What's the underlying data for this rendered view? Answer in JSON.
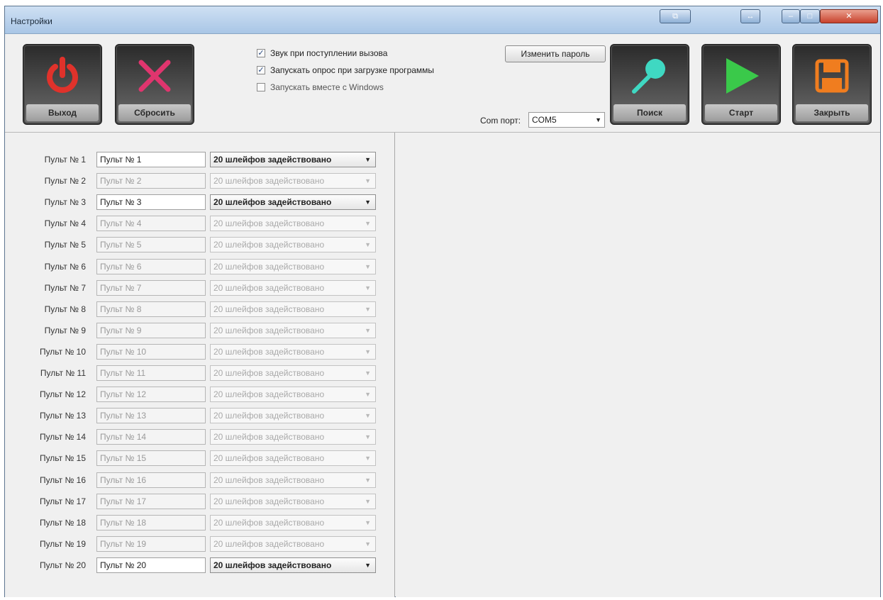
{
  "window": {
    "title": "Настройки"
  },
  "toolbar": {
    "exit_label": "Выход",
    "reset_label": "Сбросить",
    "search_label": "Поиск",
    "start_label": "Старт",
    "close_label": "Закрыть",
    "change_password_label": "Изменить пароль",
    "com_port_label": "Com порт:",
    "com_port_value": "COM5",
    "options": [
      {
        "label": "Звук при поступлении вызова",
        "checked": true
      },
      {
        "label": "Запускать опрос при загрузке программы",
        "checked": true
      },
      {
        "label": "Запускать вместе с Windows",
        "checked": false
      }
    ]
  },
  "colors": {
    "exit_icon": "#e0322b",
    "reset_icon": "#e0356e",
    "search_icon": "#3fd8c2",
    "start_icon": "#3ac94a",
    "close_icon": "#f07d1f"
  },
  "remotes": [
    {
      "label": "Пульт № 1",
      "name": "Пульт № 1",
      "mode": "20 шлейфов задействовано",
      "enabled": true
    },
    {
      "label": "Пульт № 2",
      "name": "Пульт № 2",
      "mode": "20 шлейфов задействовано",
      "enabled": false
    },
    {
      "label": "Пульт № 3",
      "name": "Пульт № 3",
      "mode": "20 шлейфов задействовано",
      "enabled": true
    },
    {
      "label": "Пульт № 4",
      "name": "Пульт № 4",
      "mode": "20 шлейфов задействовано",
      "enabled": false
    },
    {
      "label": "Пульт № 5",
      "name": "Пульт № 5",
      "mode": "20 шлейфов задействовано",
      "enabled": false
    },
    {
      "label": "Пульт № 6",
      "name": "Пульт № 6",
      "mode": "20 шлейфов задействовано",
      "enabled": false
    },
    {
      "label": "Пульт № 7",
      "name": "Пульт № 7",
      "mode": "20 шлейфов задействовано",
      "enabled": false
    },
    {
      "label": "Пульт № 8",
      "name": "Пульт № 8",
      "mode": "20 шлейфов задействовано",
      "enabled": false
    },
    {
      "label": "Пульт № 9",
      "name": "Пульт № 9",
      "mode": "20 шлейфов задействовано",
      "enabled": false
    },
    {
      "label": "Пульт № 10",
      "name": "Пульт № 10",
      "mode": "20 шлейфов задействовано",
      "enabled": false
    },
    {
      "label": "Пульт № 11",
      "name": "Пульт № 11",
      "mode": "20 шлейфов задействовано",
      "enabled": false
    },
    {
      "label": "Пульт № 12",
      "name": "Пульт № 12",
      "mode": "20 шлейфов задействовано",
      "enabled": false
    },
    {
      "label": "Пульт № 13",
      "name": "Пульт № 13",
      "mode": "20 шлейфов задействовано",
      "enabled": false
    },
    {
      "label": "Пульт № 14",
      "name": "Пульт № 14",
      "mode": "20 шлейфов задействовано",
      "enabled": false
    },
    {
      "label": "Пульт № 15",
      "name": "Пульт № 15",
      "mode": "20 шлейфов задействовано",
      "enabled": false
    },
    {
      "label": "Пульт № 16",
      "name": "Пульт № 16",
      "mode": "20 шлейфов задействовано",
      "enabled": false
    },
    {
      "label": "Пульт № 17",
      "name": "Пульт № 17",
      "mode": "20 шлейфов задействовано",
      "enabled": false
    },
    {
      "label": "Пульт № 18",
      "name": "Пульт № 18",
      "mode": "20 шлейфов задействовано",
      "enabled": false
    },
    {
      "label": "Пульт № 19",
      "name": "Пульт № 19",
      "mode": "20 шлейфов задействовано",
      "enabled": false
    },
    {
      "label": "Пульт № 20",
      "name": "Пульт № 20",
      "mode": "20 шлейфов задействовано",
      "enabled": true
    }
  ]
}
